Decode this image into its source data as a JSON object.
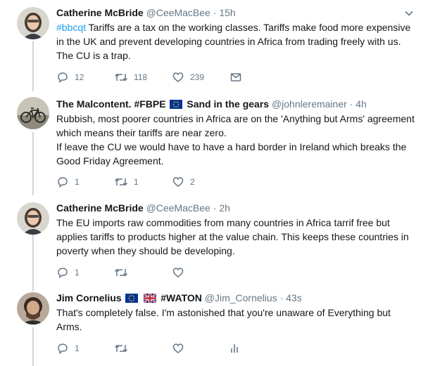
{
  "tweets": [
    {
      "name": "Catherine McBride",
      "handle": "@CeeMacBee",
      "separator": "·",
      "time": "15h",
      "hashtag": "#bbcqt",
      "text": " Tariffs are a tax on the working classes. Tariffs make food more expensive in the UK and prevent developing countries in Africa from trading freely with us. The CU is a trap.",
      "replies": "12",
      "retweets": "118",
      "likes": "239"
    },
    {
      "name": "The Malcontent. #FBPE",
      "name_suffix": "Sand in the gears",
      "handle": "@johnleremainer",
      "separator": "·",
      "time": "4h",
      "text_1": "Rubbish, most poorer countries in Africa are on the 'Anything but Arms' agreement which means their tariffs are near zero.",
      "text_2": "If leave the CU we would have to have a hard border in Ireland which breaks the Good Friday Agreement.",
      "replies": "1",
      "retweets": "1",
      "likes": "2"
    },
    {
      "name": "Catherine McBride",
      "handle": "@CeeMacBee",
      "separator": "·",
      "time": "2h",
      "text": "The EU imports raw commodities from many countries in Africa tarrif free but applies tariffs to products higher at the value chain. This keeps  these countries in poverty when they should be developing.",
      "replies": "1"
    },
    {
      "name": "Jim Cornelius",
      "name_suffix": "#WATON",
      "handle": "@Jim_Cornelius",
      "separator": "·",
      "time": "43s",
      "text": "That's completely false. I'm astonished that you're unaware of Everything but Arms.",
      "replies": "1"
    }
  ],
  "icons": {
    "reply": "reply-icon",
    "retweet": "retweet-icon",
    "like": "heart-icon",
    "message": "envelope-icon",
    "analytics": "analytics-icon",
    "caret": "chevron-down-icon",
    "eu_flag": "eu-flag-icon",
    "uk_flag": "uk-flag-icon"
  },
  "colors": {
    "link": "#1da1f2",
    "muted": "#657786",
    "thread_line": "#ccd6dd"
  }
}
